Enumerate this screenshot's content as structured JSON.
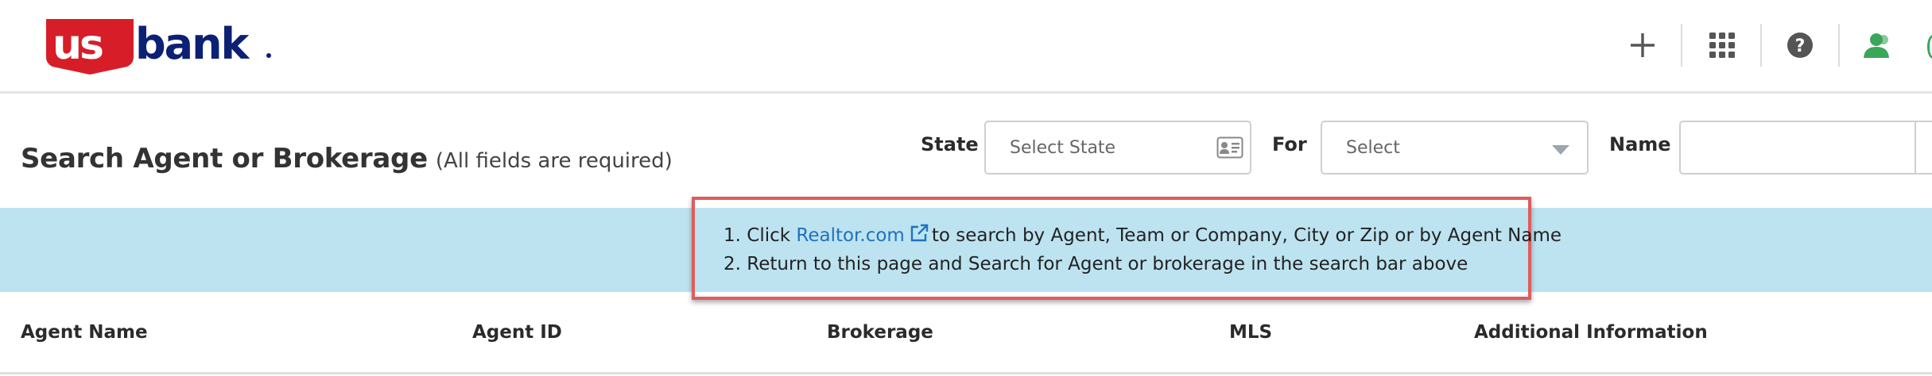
{
  "brand": {
    "logo_text": "usbank",
    "colors": {
      "red": "#d71e28",
      "navy": "#0c2074"
    }
  },
  "header_icons": [
    {
      "icon": "plus-icon"
    },
    {
      "icon": "apps-grid-icon"
    },
    {
      "icon": "help-icon"
    },
    {
      "icon": "user-icon",
      "color": "#3aa65a"
    }
  ],
  "search": {
    "title": "Search Agent or Brokerage",
    "subtitle": "(All fields are required)",
    "state_label": "State",
    "state_placeholder": "Select State",
    "for_label": "For",
    "for_placeholder": "Select",
    "name_label": "Name",
    "name_value": ""
  },
  "banner": {
    "bg_color": "#bde3f0",
    "border_color": "#e05c5c",
    "line1_prefix": "1. Click",
    "line1_link": "Realtor.com",
    "line1_suffix": "to search by Agent, Team or Company, City or Zip or by Agent Name",
    "line2": "2. Return to this page and Search for Agent or brokerage in the search bar above"
  },
  "table": {
    "columns": [
      "Agent Name",
      "Agent ID",
      "Brokerage",
      "MLS",
      "Additional Information"
    ]
  }
}
